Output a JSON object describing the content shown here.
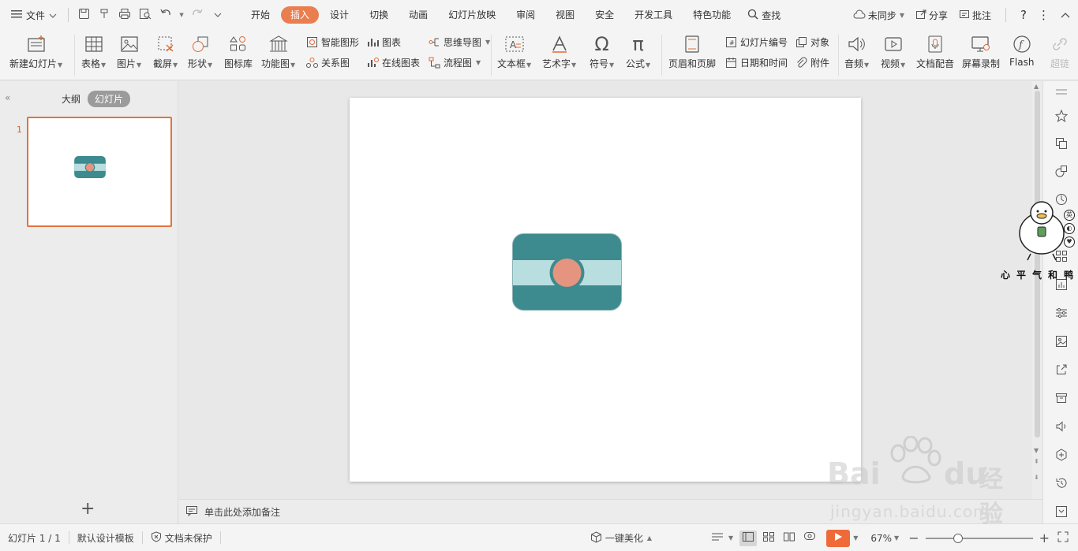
{
  "menubar": {
    "file_label": "文件",
    "tabs": [
      "开始",
      "插入",
      "设计",
      "切换",
      "动画",
      "幻灯片放映",
      "审阅",
      "视图",
      "安全",
      "开发工具",
      "特色功能"
    ],
    "active_tab": "插入",
    "search_label": "查找",
    "sync_label": "未同步",
    "share_label": "分享",
    "comment_label": "批注"
  },
  "ribbon": {
    "new_slide": "新建幻灯片",
    "table": "表格",
    "picture": "图片",
    "screenshot": "截屏",
    "shape": "形状",
    "icon_lib": "图标库",
    "func_chart": "功能图",
    "smart_shape": "智能图形",
    "chart": "图表",
    "relation": "关系图",
    "online_chart": "在线图表",
    "mind_map": "思维导图",
    "flowchart": "流程图",
    "textbox": "文本框",
    "wordart": "艺术字",
    "symbol": "符号",
    "formula": "公式",
    "header_footer": "页眉和页脚",
    "slide_number": "幻灯片编号",
    "object": "对象",
    "date_time": "日期和时间",
    "attachment": "附件",
    "audio": "音频",
    "video": "视频",
    "doc_dub": "文档配音",
    "screen_record": "屏幕录制",
    "flash": "Flash",
    "hyperlink": "超链"
  },
  "leftpanel": {
    "tab_outline": "大纲",
    "tab_slides": "幻灯片",
    "slide_number": "1",
    "add_symbol": "+"
  },
  "notes": {
    "placeholder": "单击此处添加备注"
  },
  "statusbar": {
    "slide_info": "幻灯片 1 / 1",
    "template": "默认设计模板",
    "protection": "文档未保护",
    "beautify": "一键美化",
    "zoom": "67%"
  },
  "zoom": {
    "level_fraction": 0.3
  },
  "watermark": {
    "brand": "Bai",
    "brand_tail": "du",
    "brand_cn": "经验",
    "url": "jingyan.baidu.com"
  },
  "sticker": {
    "caption": "心平气和鸭",
    "badges": [
      "英",
      "◐",
      "♥"
    ]
  },
  "colors": {
    "accent": "#ea7e4f",
    "card_dark": "#3d8a8f",
    "card_band": "#b9dee0",
    "card_circle": "#e4947f",
    "play": "#ee6b39"
  }
}
